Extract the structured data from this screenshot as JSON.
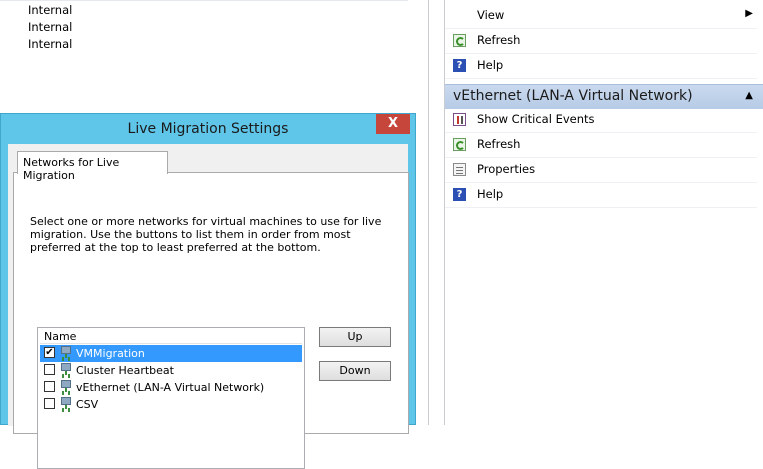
{
  "background_list": {
    "rows": [
      "Internal",
      "Internal",
      "Internal"
    ]
  },
  "actions_pane": {
    "top_items": [
      {
        "label": "View",
        "icon": "none",
        "has_submenu": true
      },
      {
        "label": "Refresh",
        "icon": "refresh-icon"
      },
      {
        "label": "Help",
        "icon": "help-icon"
      }
    ],
    "section": {
      "title": "vEthernet (LAN-A Virtual Network)",
      "items": [
        {
          "label": "Show Critical Events",
          "icon": "events-icon"
        },
        {
          "label": "Refresh",
          "icon": "refresh-icon"
        },
        {
          "label": "Properties",
          "icon": "properties-icon"
        },
        {
          "label": "Help",
          "icon": "help-icon"
        }
      ]
    }
  },
  "dialog": {
    "title": "Live Migration Settings",
    "close_glyph": "X",
    "tab_label": "Networks for Live Migration",
    "description": "Select one or more networks for virtual machines to use for live migration. Use the buttons to list them in order from most preferred at the top to least preferred at the bottom.",
    "list_header": "Name",
    "networks": [
      {
        "name": "VMMigration",
        "checked": true,
        "selected": true
      },
      {
        "name": "Cluster Heartbeat",
        "checked": false,
        "selected": false
      },
      {
        "name": "vEthernet (LAN-A Virtual Network)",
        "checked": false,
        "selected": false
      },
      {
        "name": "CSV",
        "checked": false,
        "selected": false
      }
    ],
    "up_button": "Up",
    "down_button": "Down"
  },
  "colors": {
    "dialog_frame": "#5fc6e9",
    "close_button": "#c7463b",
    "selection": "#3399ff",
    "section_header": "#c0d2ea"
  }
}
